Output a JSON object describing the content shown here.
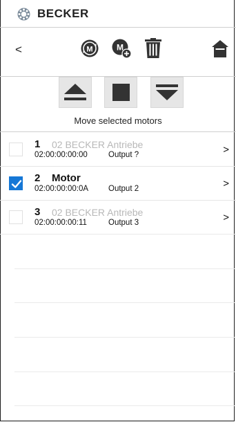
{
  "header": {
    "brand": "BECKER",
    "logo_icon": "becker-logo-icon"
  },
  "toolbar": {
    "back_label": "<",
    "icons": [
      "motor-program-icon",
      "add-motor-icon",
      "trash-icon",
      "home-icon"
    ]
  },
  "controls": {
    "up_icon": "eject-up-icon",
    "stop_icon": "stop-icon",
    "down_icon": "move-down-icon",
    "label": "Move selected motors"
  },
  "motors": [
    {
      "number": "1",
      "name": "02 BECKER Antriebe",
      "address": "02:00:00:00:00",
      "output": "Output ?",
      "selected": false,
      "arrow": ">"
    },
    {
      "number": "2",
      "name": "Motor",
      "address": "02:00:00:00:0A",
      "output": "Output 2",
      "selected": true,
      "arrow": ">"
    },
    {
      "number": "3",
      "name": "02 BECKER Antriebe",
      "address": "02:00:00:00:11",
      "output": "Output 3",
      "selected": false,
      "arrow": ">"
    }
  ],
  "colors": {
    "accent": "#1577d6",
    "inactive_text": "#b8b8b8",
    "divider": "#cfcfcf"
  }
}
